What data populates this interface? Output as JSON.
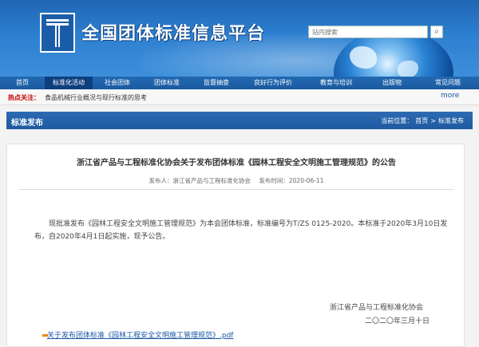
{
  "site": {
    "title": "全国团体标准信息平台",
    "search_placeholder": "站内搜索"
  },
  "nav": {
    "items": [
      {
        "label": "首页"
      },
      {
        "label": "标准化活动",
        "active": true
      },
      {
        "label": "社会团体"
      },
      {
        "label": "团体标准"
      },
      {
        "label": "监督抽查"
      },
      {
        "label": "良好行为评价"
      },
      {
        "label": "教育与培训"
      },
      {
        "label": "出版物"
      },
      {
        "label": "常见问题"
      }
    ]
  },
  "hot": {
    "label": "热点关注：",
    "item": "食品机械行业概况与现行标准的思考",
    "more": "more"
  },
  "section": {
    "title": "标准发布",
    "breadcrumb_prefix": "当前位置：",
    "crumbs": [
      "首页",
      ">",
      "标准发布"
    ]
  },
  "article": {
    "title": "浙江省产品与工程标准化协会关于发布团体标准《园林工程安全文明施工管理规范》的公告",
    "publisher": "发布人：浙江省产品与工程标准化协会",
    "date": "发布时间：2020-06-11",
    "body": "现批准发布《园林工程安全文明施工管理规范》为本会团体标准，标准编号为T/ZS 0125-2020。本标准于2020年3月10日发布，自2020年4月1日起实施，现予公告。",
    "sign_org": "浙江省产品与工程标准化协会",
    "sign_date": "二〇二〇年三月十日",
    "attachment": "关于发布团体标准《园林工程安全文明施工管理规范》.pdf"
  },
  "colors": {
    "banner": "#2d7fd0",
    "nav": "#1a5aa0",
    "nav_active": "#0d3f7e",
    "hot_label": "#c40000",
    "link": "#1a57a5"
  },
  "icons": {
    "logo": "logo-icon",
    "search": "search-icon",
    "globe": "globe-icon",
    "attachment": "pdf-icon"
  }
}
